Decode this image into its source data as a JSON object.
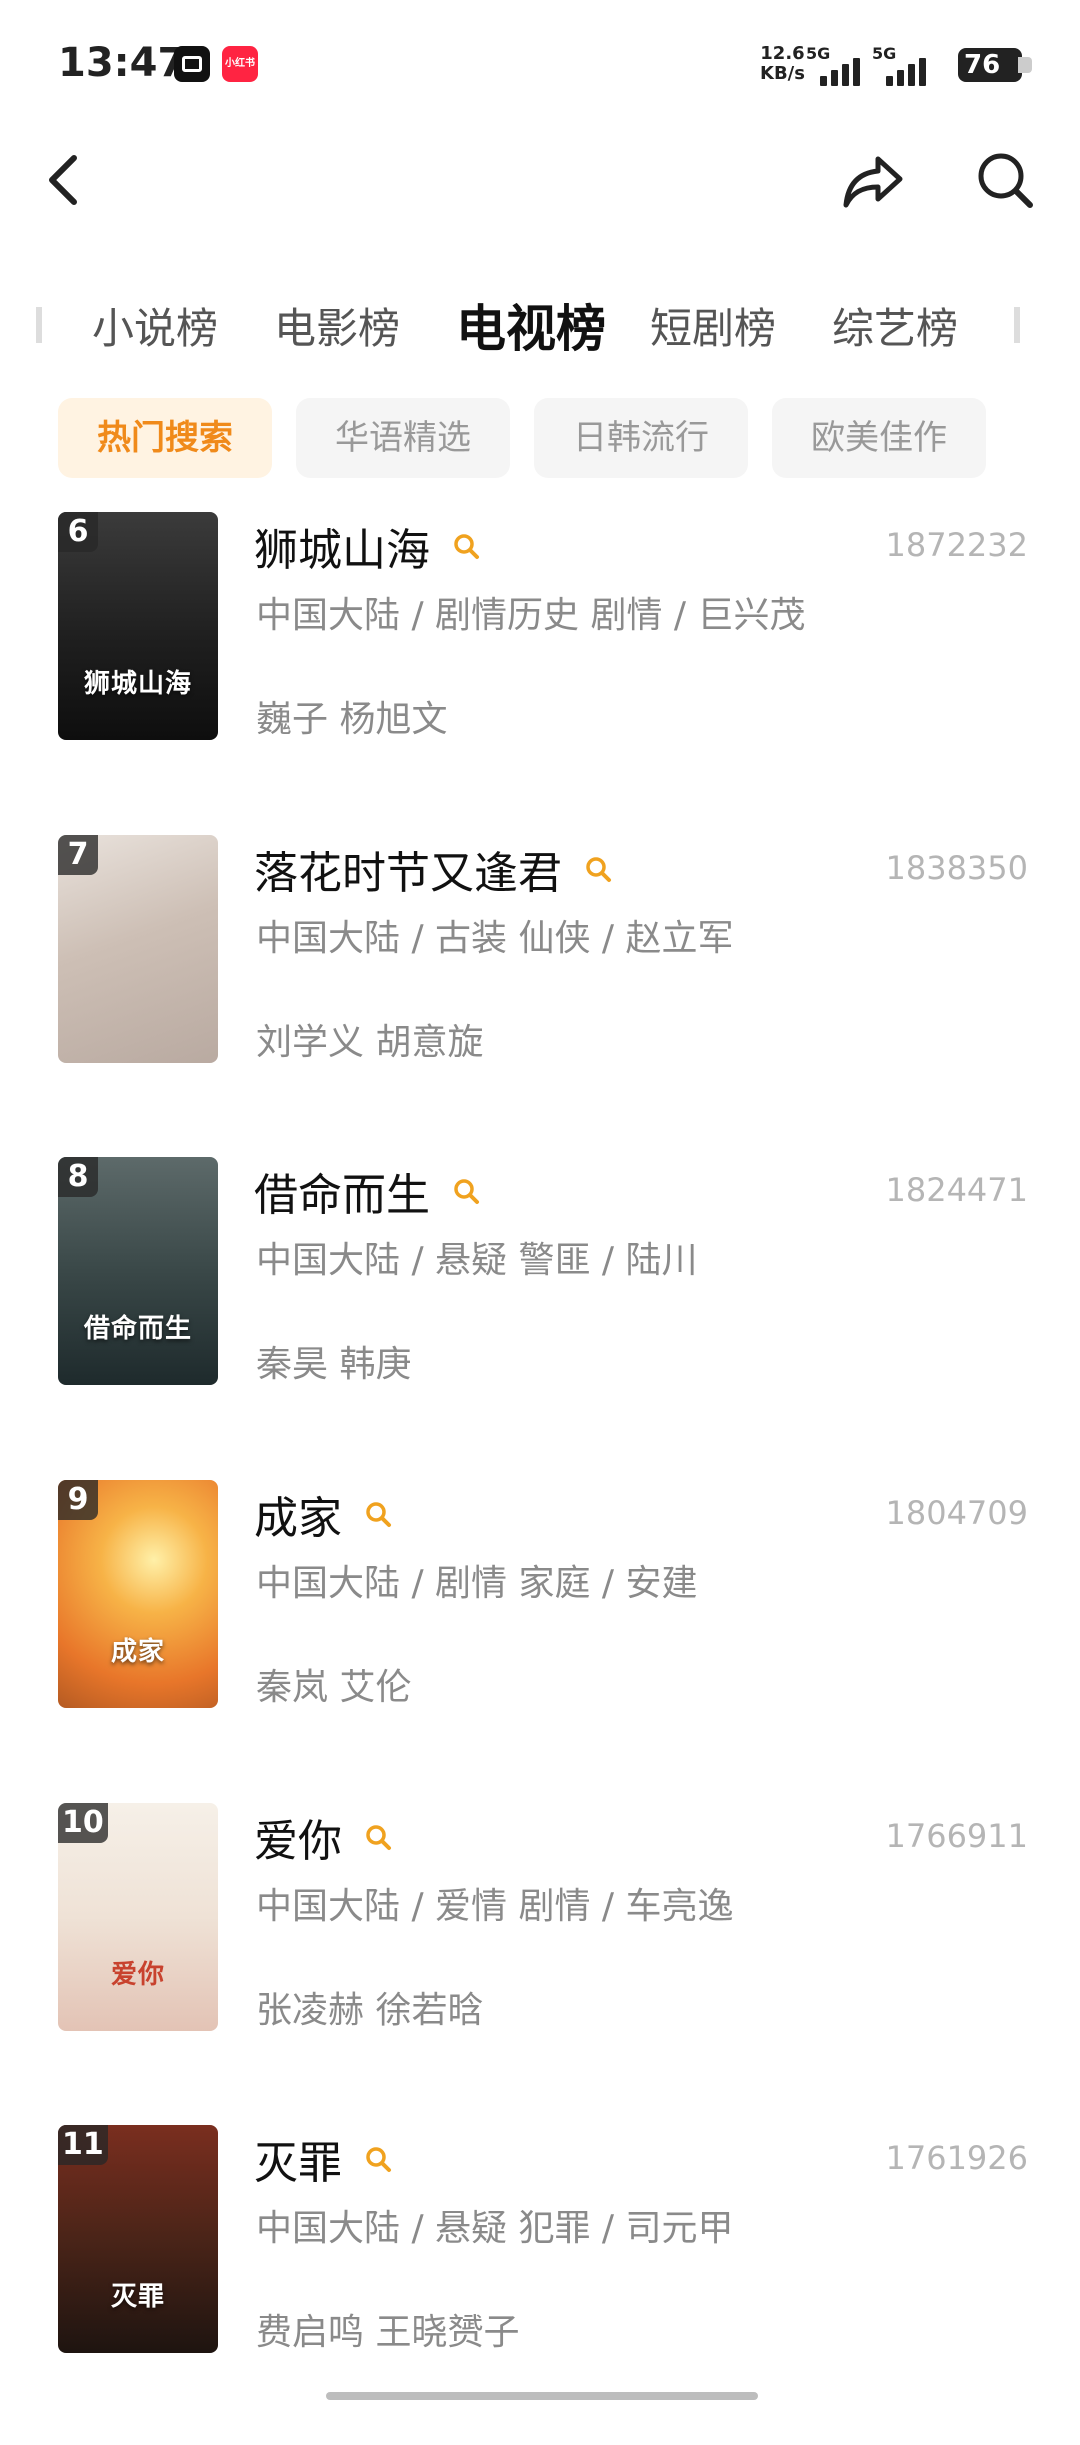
{
  "status_bar": {
    "time": "13:47",
    "xhs_badge": "小红书",
    "net_speed_value": "12.6",
    "net_speed_unit": "KB/s",
    "sim1": "5G",
    "sim2": "5G",
    "battery": "76"
  },
  "nav": {
    "back_icon": "chevron-left-icon",
    "share_icon": "share-arrow-icon",
    "search_icon": "search-icon"
  },
  "category_tabs": [
    "小说榜",
    "电影榜",
    "电视榜",
    "短剧榜",
    "综艺榜"
  ],
  "active_category": "电视榜",
  "sub_tabs": [
    "热门搜索",
    "华语精选",
    "日韩流行",
    "欧美佳作"
  ],
  "active_sub_tab": "热门搜索",
  "colors": {
    "accent": "#f0a21f",
    "accent_text": "#f08a1a",
    "meta": "#8a8a8a",
    "score": "#b5b5b5"
  },
  "items": [
    {
      "rank": "6",
      "title": "狮城山海",
      "score": "1872232",
      "meta": "中国大陆 / 剧情历史 剧情 / 巨兴茂",
      "cast": "巍子 杨旭文",
      "poster_text": "狮城山海"
    },
    {
      "rank": "7",
      "title": "落花时节又逢君",
      "score": "1838350",
      "meta": "中国大陆 / 古装 仙侠 / 赵立军",
      "cast": "刘学义 胡意旋",
      "poster_text": ""
    },
    {
      "rank": "8",
      "title": "借命而生",
      "score": "1824471",
      "meta": "中国大陆 / 悬疑 警匪 / 陆川",
      "cast": "秦昊 韩庚",
      "poster_text": "借命而生"
    },
    {
      "rank": "9",
      "title": "成家",
      "score": "1804709",
      "meta": "中国大陆 / 剧情 家庭 / 安建",
      "cast": "秦岚 艾伦",
      "poster_text": "成家"
    },
    {
      "rank": "10",
      "title": "爱你",
      "score": "1766911",
      "meta": "中国大陆 / 爱情 剧情 / 车亮逸",
      "cast": "张凌赫 徐若晗",
      "poster_text": "爱你"
    },
    {
      "rank": "11",
      "title": "灭罪",
      "score": "1761926",
      "meta": "中国大陆 / 悬疑 犯罪 / 司元甲",
      "cast": "费启鸣 王晓赟子",
      "poster_text": "灭罪"
    }
  ]
}
